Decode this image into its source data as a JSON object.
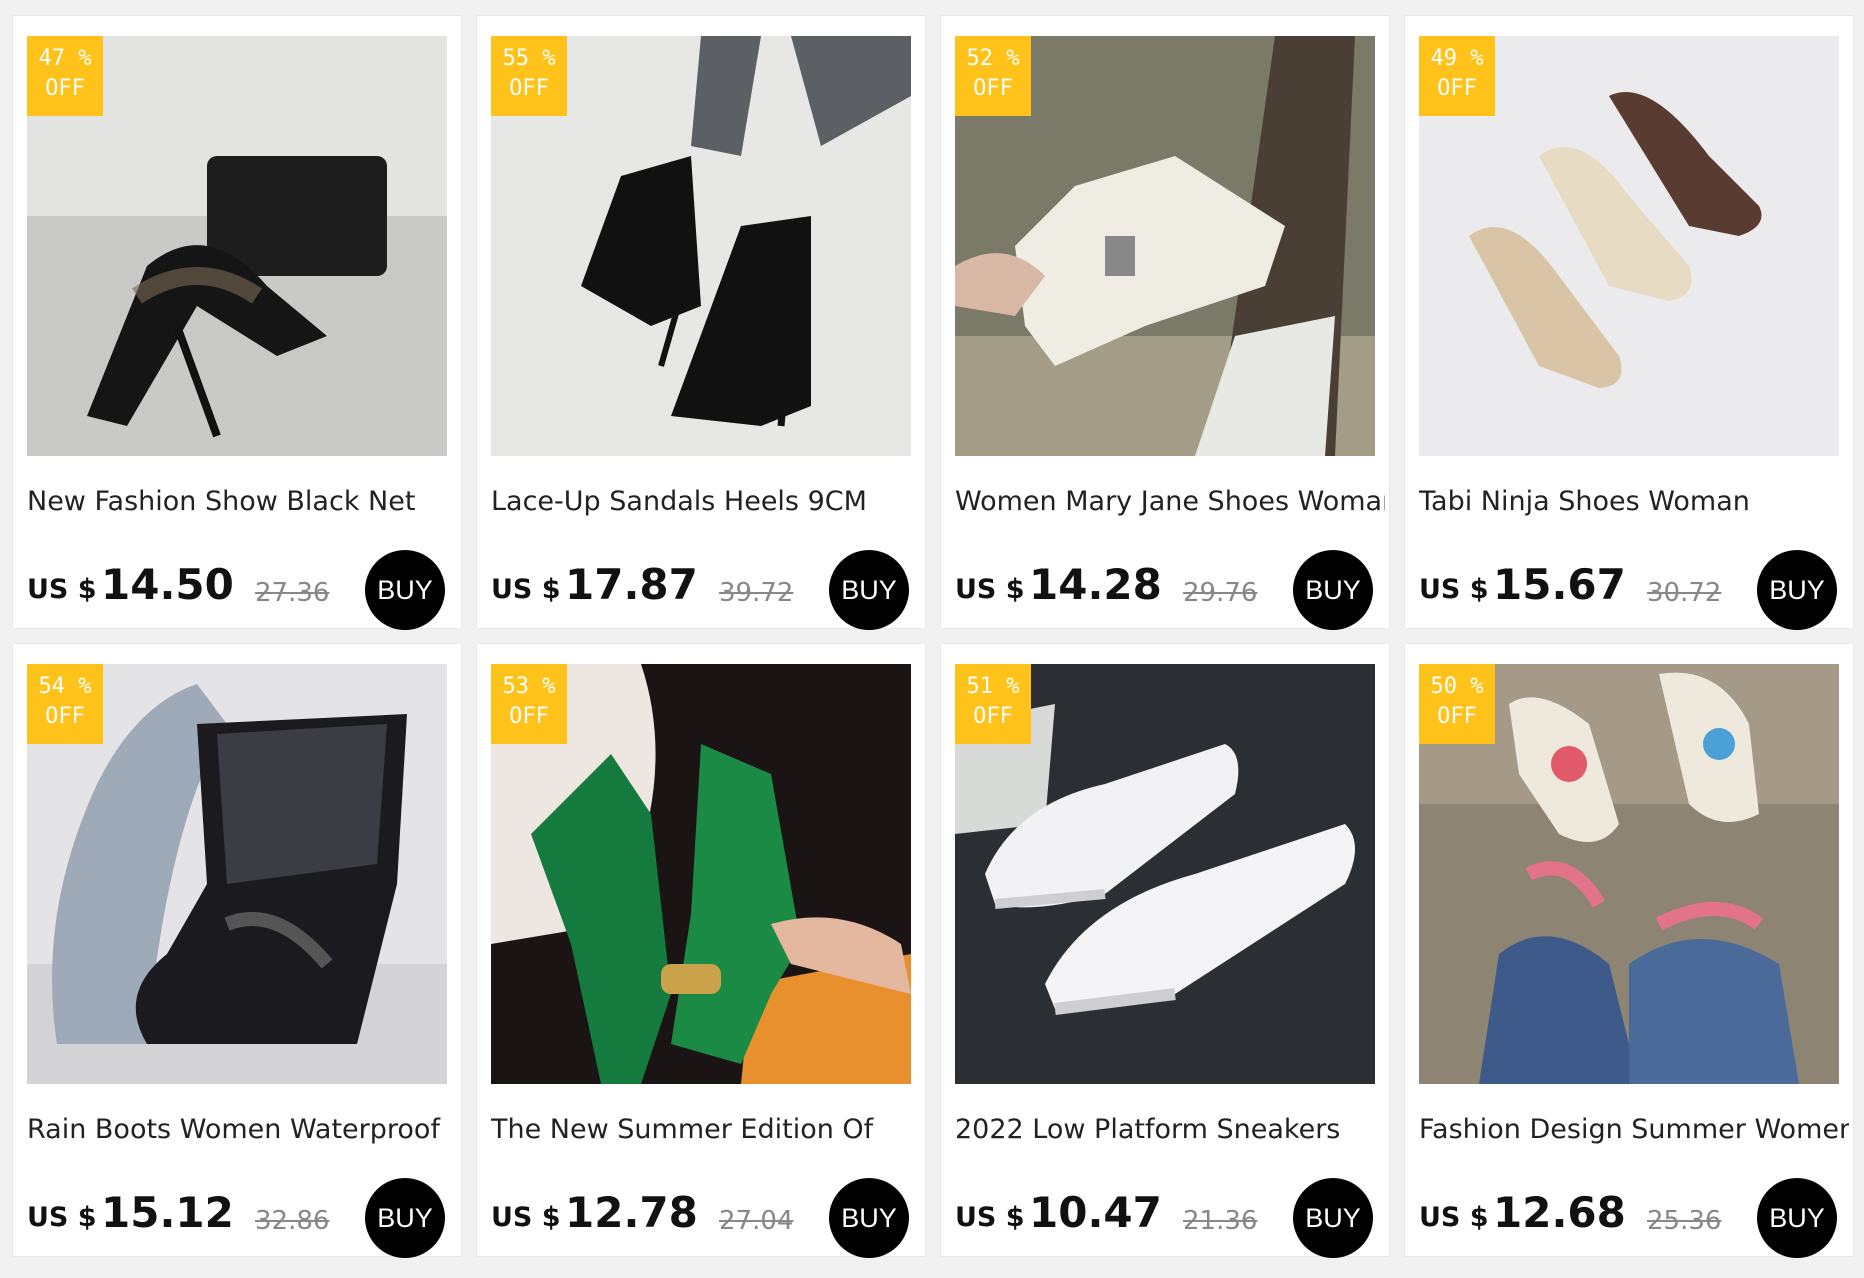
{
  "products": [
    {
      "discount": "47 %",
      "off": "OFF",
      "title": "New Fashion Show Black Net",
      "currency": "US $",
      "price": "14.50",
      "old_price": "27.36",
      "buy": "BUY"
    },
    {
      "discount": "55 %",
      "off": "OFF",
      "title": "Lace-Up Sandals Heels 9CM",
      "currency": "US $",
      "price": "17.87",
      "old_price": "39.72",
      "buy": "BUY"
    },
    {
      "discount": "52 %",
      "off": "OFF",
      "title": "Women Mary Jane Shoes Woman",
      "currency": "US $",
      "price": "14.28",
      "old_price": "29.76",
      "buy": "BUY"
    },
    {
      "discount": "49 %",
      "off": "OFF",
      "title": "Tabi Ninja Shoes Woman",
      "currency": "US $",
      "price": "15.67",
      "old_price": "30.72",
      "buy": "BUY"
    },
    {
      "discount": "54 %",
      "off": "OFF",
      "title": "Rain Boots Women Waterproof",
      "currency": "US $",
      "price": "15.12",
      "old_price": "32.86",
      "buy": "BUY"
    },
    {
      "discount": "53 %",
      "off": "OFF",
      "title": "The New Summer Edition Of",
      "currency": "US $",
      "price": "12.78",
      "old_price": "27.04",
      "buy": "BUY"
    },
    {
      "discount": "51 %",
      "off": "OFF",
      "title": "2022 Low Platform Sneakers",
      "currency": "US $",
      "price": "10.47",
      "old_price": "21.36",
      "buy": "BUY"
    },
    {
      "discount": "50 %",
      "off": "OFF",
      "title": "Fashion Design Summer Women",
      "currency": "US $",
      "price": "12.68",
      "old_price": "25.36",
      "buy": "BUY"
    }
  ],
  "colors": {
    "badge": "#ffc21a",
    "buy_button": "#000000",
    "background": "#f1f1f1"
  }
}
